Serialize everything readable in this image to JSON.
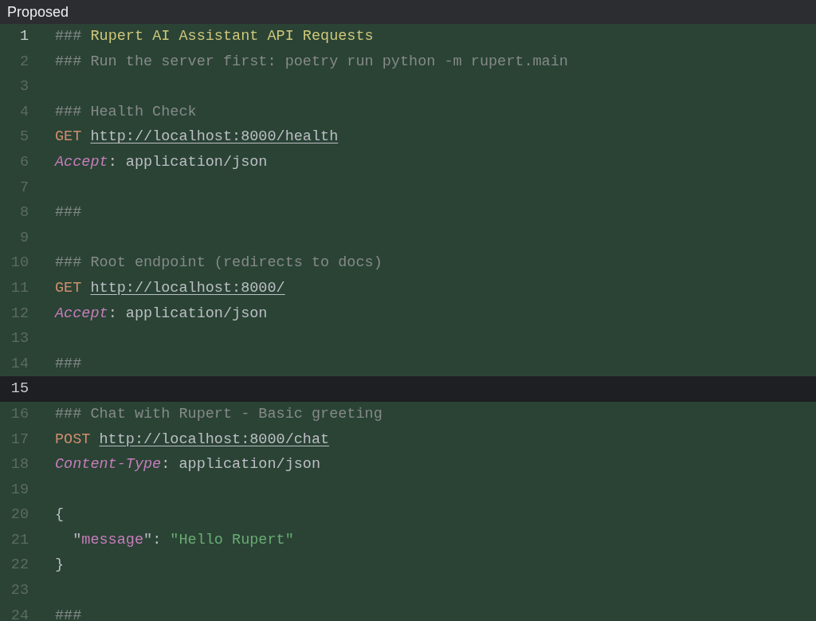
{
  "panel": {
    "title": "Proposed"
  },
  "lines": [
    {
      "number": "1",
      "current": false,
      "number_bright": true,
      "tokens": [
        {
          "kind": "comment",
          "text": "### "
        },
        {
          "kind": "title",
          "text": "Rupert AI Assistant API Requests"
        }
      ]
    },
    {
      "number": "2",
      "current": false,
      "number_bright": false,
      "tokens": [
        {
          "kind": "comment",
          "text": "### Run the server first: poetry run python -m rupert.main"
        }
      ]
    },
    {
      "number": "3",
      "current": false,
      "number_bright": false
    },
    {
      "number": "4",
      "current": false,
      "number_bright": false,
      "tokens": [
        {
          "kind": "comment",
          "text": "### Health Check"
        }
      ]
    },
    {
      "number": "5",
      "current": false,
      "number_bright": false,
      "tokens": [
        {
          "kind": "method",
          "text": "GET "
        },
        {
          "kind": "url",
          "text": "http://localhost:8000/health"
        }
      ]
    },
    {
      "number": "6",
      "current": false,
      "number_bright": false,
      "tokens": [
        {
          "kind": "header",
          "text": "Accept"
        },
        {
          "kind": "text",
          "text": ": application/json"
        }
      ]
    },
    {
      "number": "7",
      "current": false,
      "number_bright": false
    },
    {
      "number": "8",
      "current": false,
      "number_bright": false,
      "tokens": [
        {
          "kind": "comment",
          "text": "###"
        }
      ]
    },
    {
      "number": "9",
      "current": false,
      "number_bright": false
    },
    {
      "number": "10",
      "current": false,
      "number_bright": false,
      "tokens": [
        {
          "kind": "comment",
          "text": "### Root endpoint (redirects to docs)"
        }
      ]
    },
    {
      "number": "11",
      "current": false,
      "number_bright": false,
      "tokens": [
        {
          "kind": "method",
          "text": "GET "
        },
        {
          "kind": "url",
          "text": "http://localhost:8000/"
        }
      ]
    },
    {
      "number": "12",
      "current": false,
      "number_bright": false,
      "tokens": [
        {
          "kind": "header",
          "text": "Accept"
        },
        {
          "kind": "text",
          "text": ": application/json"
        }
      ]
    },
    {
      "number": "13",
      "current": false,
      "number_bright": false
    },
    {
      "number": "14",
      "current": false,
      "number_bright": false,
      "tokens": [
        {
          "kind": "comment",
          "text": "###"
        }
      ]
    },
    {
      "number": "15",
      "current": true,
      "number_bright": true
    },
    {
      "number": "16",
      "current": false,
      "number_bright": false,
      "tokens": [
        {
          "kind": "comment",
          "text": "### Chat with Rupert - Basic greeting"
        }
      ]
    },
    {
      "number": "17",
      "current": false,
      "number_bright": false,
      "tokens": [
        {
          "kind": "method",
          "text": "POST "
        },
        {
          "kind": "url",
          "text": "http://localhost:8000/chat"
        }
      ]
    },
    {
      "number": "18",
      "current": false,
      "number_bright": false,
      "tokens": [
        {
          "kind": "header",
          "text": "Content-Type"
        },
        {
          "kind": "text",
          "text": ": application/json"
        }
      ]
    },
    {
      "number": "19",
      "current": false,
      "number_bright": false
    },
    {
      "number": "20",
      "current": false,
      "number_bright": false,
      "tokens": [
        {
          "kind": "text",
          "text": "{"
        }
      ]
    },
    {
      "number": "21",
      "current": false,
      "number_bright": false,
      "tokens": [
        {
          "kind": "text",
          "text": "  \""
        },
        {
          "kind": "key",
          "text": "message"
        },
        {
          "kind": "text",
          "text": "\": "
        },
        {
          "kind": "string",
          "text": "\"Hello Rupert\""
        }
      ]
    },
    {
      "number": "22",
      "current": false,
      "number_bright": false,
      "tokens": [
        {
          "kind": "text",
          "text": "}"
        }
      ]
    },
    {
      "number": "23",
      "current": false,
      "number_bright": false
    },
    {
      "number": "24",
      "current": false,
      "number_bright": false,
      "tokens": [
        {
          "kind": "comment",
          "text": "###"
        }
      ]
    }
  ]
}
